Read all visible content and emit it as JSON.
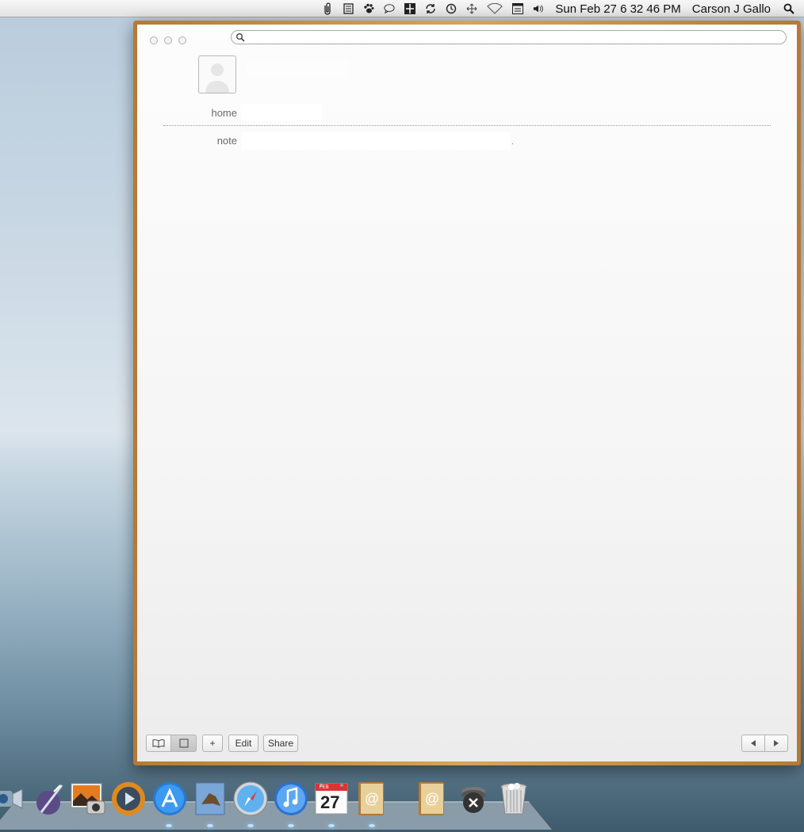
{
  "menubar": {
    "icons": [
      "paperclip-icon",
      "notes-icon",
      "paw-icon",
      "chat-bubble-icon",
      "status-icon",
      "sync-icon",
      "time-machine-icon",
      "move-icon",
      "wifi-icon",
      "calendar-icon",
      "volume-icon"
    ],
    "datetime": "Sun Feb 27  6 32 46 PM",
    "user": "Carson J Gallo"
  },
  "window": {
    "search": {
      "value": "",
      "placeholder": ""
    },
    "card": {
      "fields": [
        {
          "label": "home",
          "value": ""
        },
        {
          "label": "note",
          "value": ""
        }
      ],
      "note_mark": "."
    },
    "toolbar": {
      "add_label": "+",
      "edit_label": "Edit",
      "share_label": "Share"
    }
  },
  "dock": {
    "items": [
      "facetime-icon",
      "quill-icon",
      "iphoto-icon",
      "quicktime-icon",
      "app-store-icon",
      "preview-icon",
      "safari-icon",
      "itunes-icon",
      "calendar-icon",
      "address-book-icon",
      "address-book-icon",
      "unknown-app-icon",
      "trash-icon"
    ],
    "calendar_month": "FEB",
    "calendar_day": "27"
  }
}
